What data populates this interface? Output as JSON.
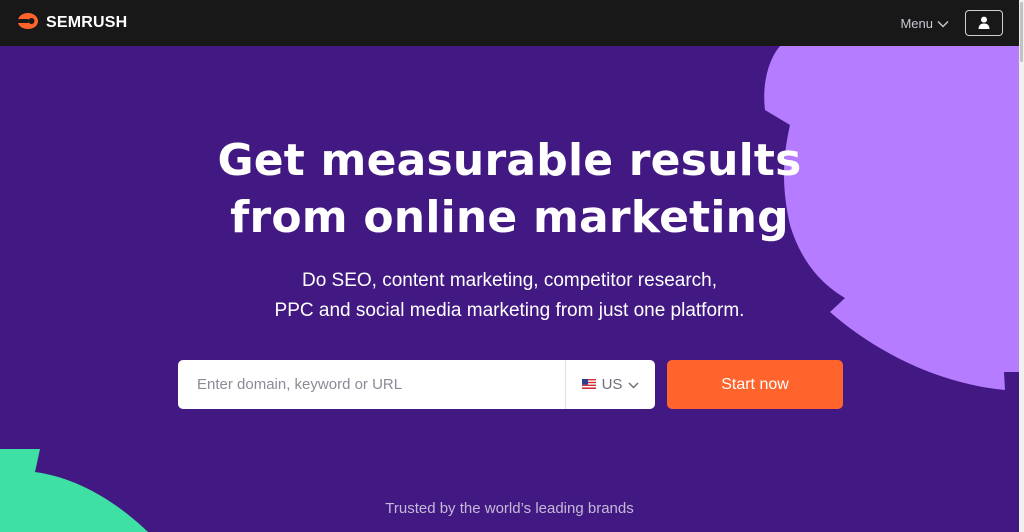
{
  "colors": {
    "background": "#421983",
    "topbar": "#181818",
    "accent_orange": "#ff642d",
    "deco_lavender": "#b57cff",
    "deco_mint": "#3fe0a3"
  },
  "header": {
    "brand_name": "SEMRUSH",
    "brand_icon": "semrush-flame-icon",
    "menu_label": "Menu",
    "user_icon": "user-icon"
  },
  "hero": {
    "headline_line1": "Get measurable results",
    "headline_line2": "from online marketing",
    "subhead_line1": "Do SEO, content marketing, competitor research,",
    "subhead_line2": "PPC and social media marketing from just one platform."
  },
  "search": {
    "placeholder": "Enter domain, keyword or URL",
    "value": "",
    "country_code": "US",
    "country_flag": "us-flag-icon",
    "button_label": "Start now"
  },
  "footer": {
    "trusted_text": "Trusted by the world’s leading brands"
  }
}
